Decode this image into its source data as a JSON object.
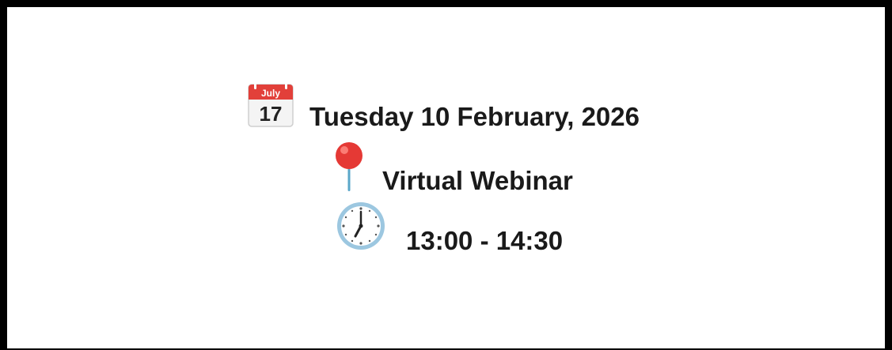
{
  "event": {
    "date": {
      "icon": "calendar-icon",
      "calendar_month": "July",
      "calendar_day": "17",
      "text": "Tuesday 10 February, 2026"
    },
    "location": {
      "icon": "round-pushpin-icon",
      "text": "Virtual Webinar"
    },
    "time": {
      "icon": "clock-seven-icon",
      "text": "13:00 - 14:30"
    }
  },
  "colors": {
    "frame": "#000000",
    "background": "#ffffff",
    "text": "#1a1a1a",
    "calendar_header": "#e2403a",
    "pin_head": "#e53935",
    "clock_rim": "#9cc7e0"
  }
}
